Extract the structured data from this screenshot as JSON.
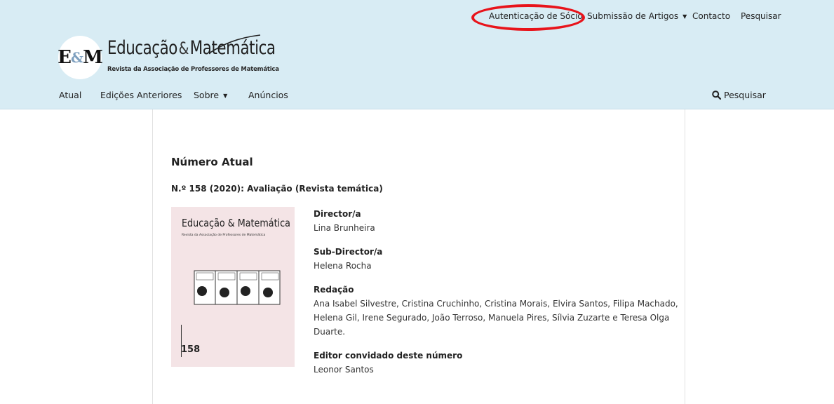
{
  "user_nav": {
    "login": "Autenticação de Sócio",
    "submissions": "Submissão de Artigos",
    "contact": "Contacto",
    "search": "Pesquisar"
  },
  "logo": {
    "mark_left": "E",
    "mark_amp": "&",
    "mark_right": "M",
    "title_part1": "Educação",
    "title_part2": "Matemática",
    "subtitle": "Revista da Associação de Professores de Matemática"
  },
  "main_nav": {
    "items": [
      "Atual",
      "Edições Anteriores",
      "Sobre",
      "Anúncios"
    ],
    "search": "Pesquisar"
  },
  "content": {
    "section_title": "Número Atual",
    "issue_title": "N.º 158 (2020): Avaliação (Revista temática)",
    "cover": {
      "title_part1": "Educação",
      "title_part2": "Matemática",
      "subtitle": "Revista da Associação de Professores de Matemática",
      "number": "158"
    },
    "fields": [
      {
        "label": "Director/a",
        "value": "Lina Brunheira"
      },
      {
        "label": "Sub-Director/a",
        "value": "Helena Rocha"
      },
      {
        "label": "Redação",
        "value": "Ana Isabel Silvestre, Cristina Cruchinho, Cristina Morais, Elvira Santos, Filipa Machado, Helena Gil, Irene Segurado, João Terroso, Manuela Pires, Sílvia Zuzarte e Teresa Olga Duarte."
      },
      {
        "label": "Editor convidado deste número",
        "value": "Leonor Santos"
      }
    ]
  },
  "colors": {
    "header_bg": "#d8ecf4",
    "annotation": "#e8141b",
    "cover_bg": "#f4e4e6"
  }
}
